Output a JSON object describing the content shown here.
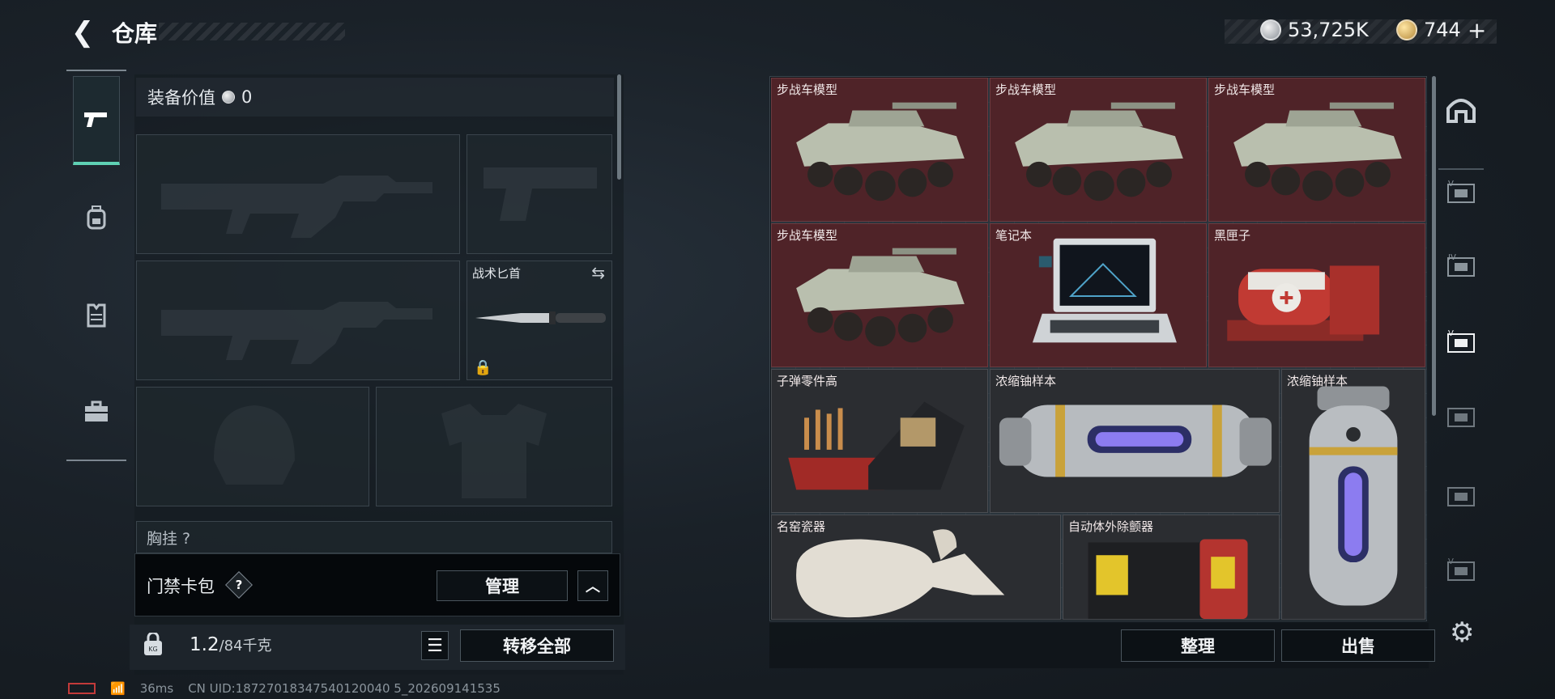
{
  "header": {
    "back_icon": "chevron-left-icon",
    "title": "仓库",
    "currency_silver": "53,725K",
    "currency_gold": "744",
    "currency_gold_add": "+"
  },
  "nav": {
    "items": [
      {
        "name": "firearms-tab",
        "icon": "pistol-icon",
        "active": true
      },
      {
        "name": "backpack-tab",
        "icon": "backpack-icon",
        "active": false
      },
      {
        "name": "vest-tab",
        "icon": "vest-icon",
        "active": false
      },
      {
        "name": "case-tab",
        "icon": "briefcase-icon",
        "active": false
      }
    ]
  },
  "equipment": {
    "value_label": "装备价值",
    "value": "0",
    "melee_label": "战术匕首",
    "chest_label": "胸挂 ?",
    "keycard_label": "门禁卡包",
    "keycard_help": "?",
    "manage_button": "管理",
    "weight_current": "1.2",
    "weight_max": "/84千克",
    "transfer_all_button": "转移全部"
  },
  "stash": {
    "items": [
      {
        "label": "步战车模型",
        "kind": "ifv"
      },
      {
        "label": "步战车模型",
        "kind": "ifv"
      },
      {
        "label": "步战车模型",
        "kind": "ifv"
      },
      {
        "label": "步战车模型",
        "kind": "ifv"
      },
      {
        "label": "笔记本",
        "kind": "laptop"
      },
      {
        "label": "黑匣子",
        "kind": "blackbox"
      },
      {
        "label": "子弹零件高",
        "kind": "ammo"
      },
      {
        "label": "浓缩铀样本",
        "kind": "uranium-h"
      },
      {
        "label": "浓缩铀样本",
        "kind": "uranium-v"
      },
      {
        "label": "名窑瓷器",
        "kind": "vase"
      },
      {
        "label": "自动体外除颤器",
        "kind": "aed"
      }
    ],
    "sort_button": "整理",
    "sell_button": "出售"
  },
  "status": {
    "ping": "36ms",
    "uid": "CN UID:18727018347540120040 5_202609141535"
  },
  "colors": {
    "accent": "#5fd1b4",
    "item_red": "#4f2328"
  }
}
